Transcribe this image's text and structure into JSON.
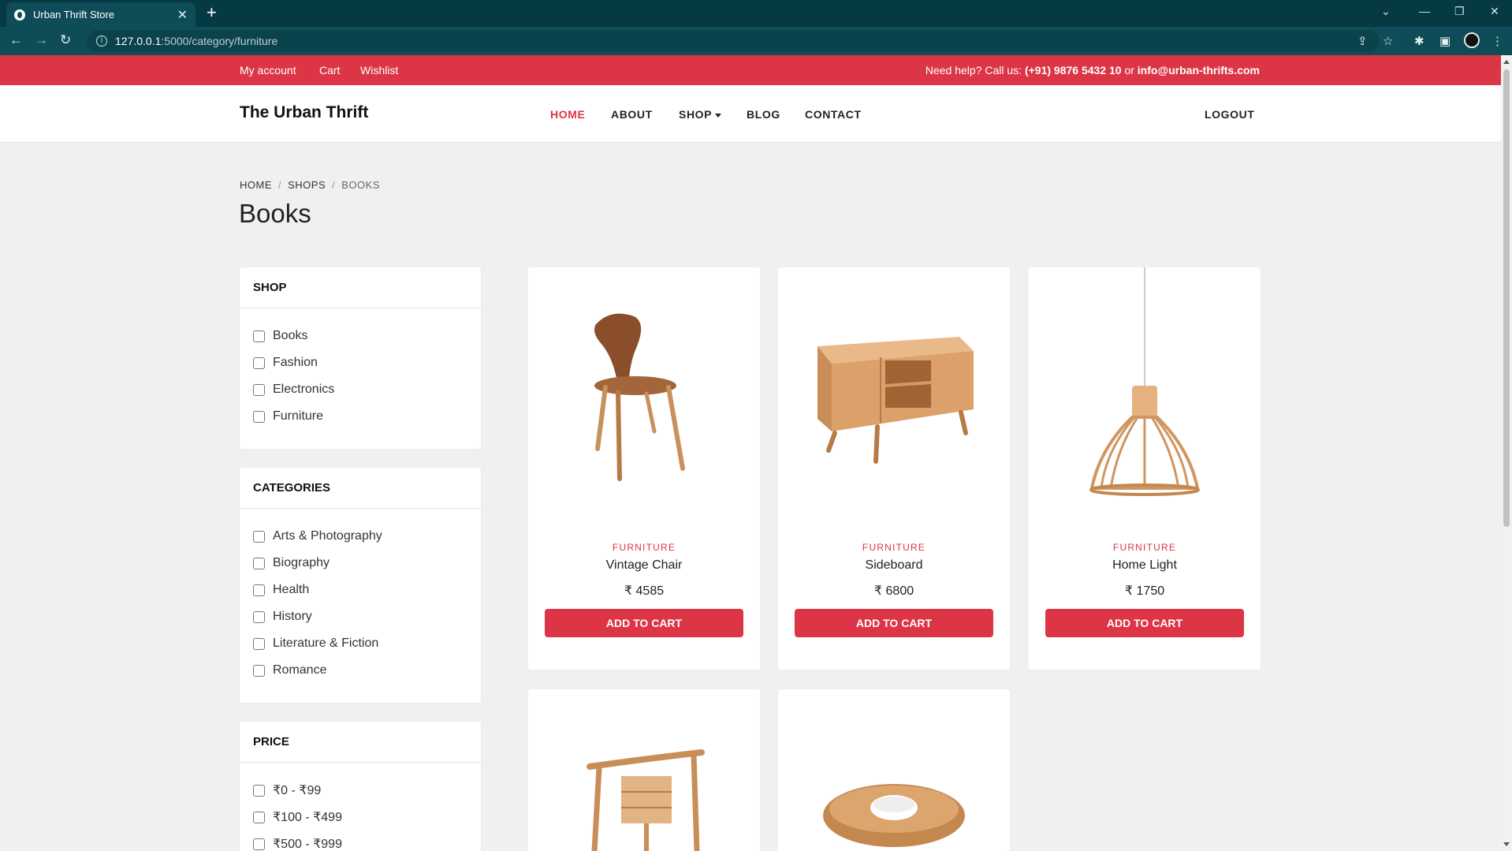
{
  "browser": {
    "tab_title": "Urban Thrift Store",
    "url_host": "127.0.0.1",
    "url_path": ":5000/category/furniture"
  },
  "topbar": {
    "links": [
      "My account",
      "Cart",
      "Wishlist"
    ],
    "help_prefix": "Need help? Call us: ",
    "phone": "(+91) 9876 5432 10",
    "or": " or ",
    "email": "info@urban-thrifts.com"
  },
  "header": {
    "brand": "The Urban Thrift",
    "nav": [
      "HOME",
      "ABOUT",
      "SHOP",
      "BLOG",
      "CONTACT"
    ],
    "logout": "LOGOUT"
  },
  "breadcrumb": [
    "HOME",
    "SHOPS",
    "BOOKS"
  ],
  "page_title": "Books",
  "sidebar": {
    "shop": {
      "title": "SHOP",
      "items": [
        "Books",
        "Fashion",
        "Electronics",
        "Furniture"
      ]
    },
    "categories": {
      "title": "CATEGORIES",
      "items": [
        "Arts & Photography",
        "Biography",
        "Health",
        "History",
        "Literature & Fiction",
        "Romance"
      ]
    },
    "price": {
      "title": "PRICE",
      "items": [
        "₹0 - ₹99",
        "₹100 - ₹499",
        "₹500 - ₹999"
      ]
    }
  },
  "products": [
    {
      "category": "FURNITURE",
      "name": "Vintage Chair",
      "price": "₹ 4585",
      "button": "ADD TO CART"
    },
    {
      "category": "FURNITURE",
      "name": "Sideboard",
      "price": "₹ 6800",
      "button": "ADD TO CART"
    },
    {
      "category": "FURNITURE",
      "name": "Home Light",
      "price": "₹ 1750",
      "button": "ADD TO CART"
    }
  ],
  "colors": {
    "accent": "#dc3545",
    "chrome": "#0e4d57",
    "chrome_dark": "#063a42"
  }
}
